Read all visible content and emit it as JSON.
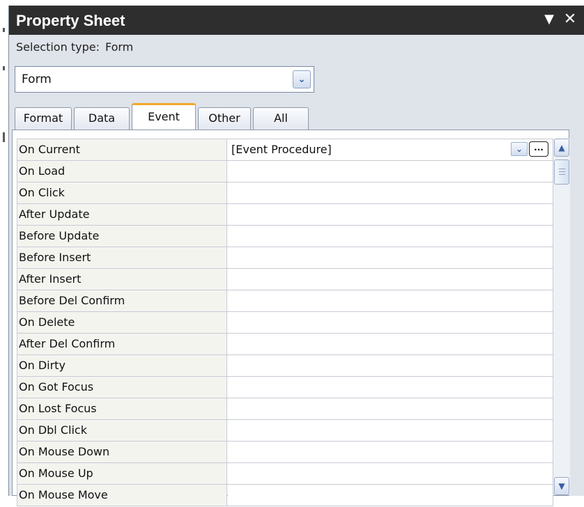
{
  "window": {
    "title": "Property Sheet",
    "menu_glyph": "▼",
    "close_glyph": "✕"
  },
  "selection": {
    "label": "Selection type:",
    "value": "Form"
  },
  "object_combo": {
    "value": "Form",
    "dropdown_glyph": "⌄"
  },
  "tabs": [
    {
      "label": "Format",
      "active": false
    },
    {
      "label": "Data",
      "active": false
    },
    {
      "label": "Event",
      "active": true
    },
    {
      "label": "Other",
      "active": false
    },
    {
      "label": "All",
      "active": false
    }
  ],
  "properties": [
    {
      "name": "On Current",
      "value": "[Event Procedure]"
    },
    {
      "name": "On Load",
      "value": ""
    },
    {
      "name": "On Click",
      "value": ""
    },
    {
      "name": "After Update",
      "value": ""
    },
    {
      "name": "Before Update",
      "value": ""
    },
    {
      "name": "Before Insert",
      "value": ""
    },
    {
      "name": "After Insert",
      "value": ""
    },
    {
      "name": "Before Del Confirm",
      "value": ""
    },
    {
      "name": "On Delete",
      "value": ""
    },
    {
      "name": "After Del Confirm",
      "value": ""
    },
    {
      "name": "On Dirty",
      "value": ""
    },
    {
      "name": "On Got Focus",
      "value": ""
    },
    {
      "name": "On Lost Focus",
      "value": ""
    },
    {
      "name": "On Dbl Click",
      "value": ""
    },
    {
      "name": "On Mouse Down",
      "value": ""
    },
    {
      "name": "On Mouse Up",
      "value": ""
    },
    {
      "name": "On Mouse Move",
      "value": ""
    }
  ],
  "active_row": {
    "dropdown_glyph": "⌄",
    "build_glyph": "..."
  },
  "scrollbar": {
    "up_glyph": "▲",
    "down_glyph": "▼"
  }
}
